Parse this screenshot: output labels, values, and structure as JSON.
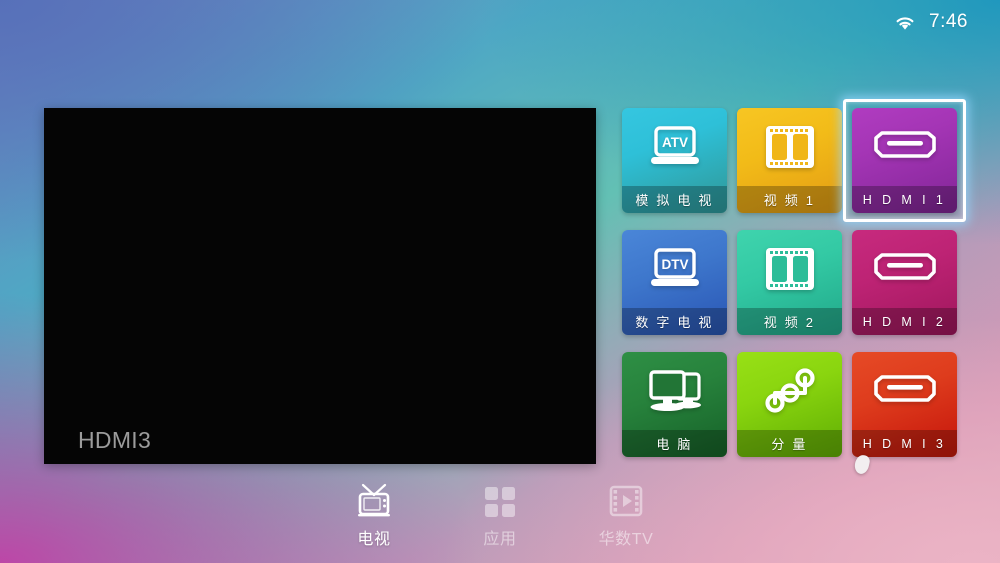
{
  "status_bar": {
    "wifi_icon": "wifi-icon",
    "time": "7:46"
  },
  "preview": {
    "current_source_label": "HDMI3",
    "background_color": "#050505"
  },
  "source_grid": {
    "selected_index": 2,
    "tiles": [
      {
        "id": "atv",
        "label": "模 拟 电 视",
        "icon": "laptop-atv-icon",
        "icon_text": "ATV",
        "color": "#2fb8c9",
        "script": "cjk"
      },
      {
        "id": "video1",
        "label": "视 频 1",
        "icon": "film-strip-icon",
        "icon_text": "",
        "color": "#f0b618",
        "script": "cjk"
      },
      {
        "id": "hdmi1",
        "label": "H D M I 1",
        "icon": "hdmi-port-icon",
        "icon_text": "",
        "color": "#9c30ab",
        "script": "latin"
      },
      {
        "id": "dtv",
        "label": "数 字 电 视",
        "icon": "laptop-dtv-icon",
        "icon_text": "DTV",
        "color": "#366cc4",
        "script": "cjk"
      },
      {
        "id": "video2",
        "label": "视 频 2",
        "icon": "film-strip-icon",
        "icon_text": "",
        "color": "#2cbd99",
        "script": "cjk"
      },
      {
        "id": "hdmi2",
        "label": "H D M I 2",
        "icon": "hdmi-port-icon",
        "icon_text": "",
        "color": "#b31e6c",
        "script": "latin"
      },
      {
        "id": "pc",
        "label": "电 脑",
        "icon": "dual-monitor-icon",
        "icon_text": "",
        "color": "#227536",
        "script": "cjk"
      },
      {
        "id": "component",
        "label": "分 量",
        "icon": "component-nodes-icon",
        "icon_text": "",
        "color": "#7ec40b",
        "script": "cjk"
      },
      {
        "id": "hdmi3",
        "label": "H D M I 3",
        "icon": "hdmi-port-icon",
        "icon_text": "",
        "color": "#d52e16",
        "script": "latin"
      }
    ]
  },
  "bottom_nav": {
    "items": [
      {
        "id": "tv",
        "label": "电视",
        "icon": "television-icon",
        "active": true
      },
      {
        "id": "apps",
        "label": "应用",
        "icon": "grid-apps-icon",
        "active": false
      },
      {
        "id": "wasutv",
        "label": "华数TV",
        "icon": "video-play-icon",
        "active": false
      }
    ]
  },
  "theme": {
    "selection_border": "#ffffff",
    "selection_glow": "#96d7ff",
    "label_band": "rgba(0,0,0,0.26)"
  }
}
